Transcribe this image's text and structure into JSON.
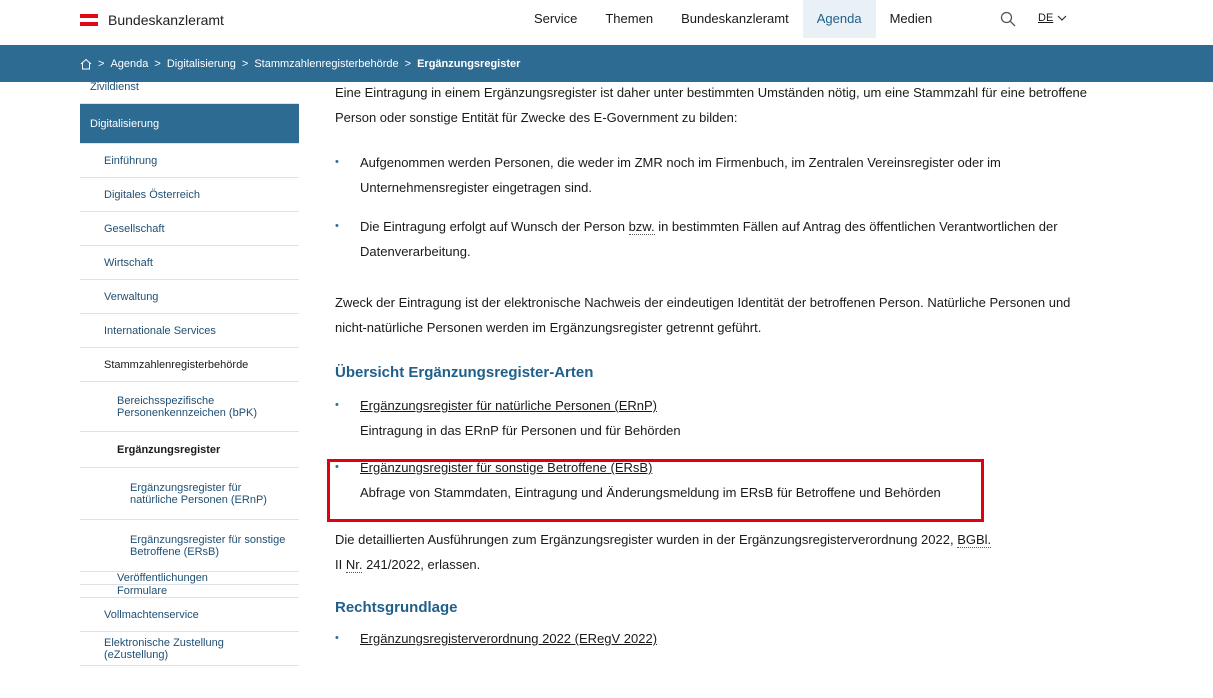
{
  "header": {
    "logo_text": "Bundeskanzleramt",
    "nav": [
      {
        "label": "Service",
        "active": false
      },
      {
        "label": "Themen",
        "active": false
      },
      {
        "label": "Bundeskanzleramt",
        "active": false
      },
      {
        "label": "Agenda",
        "active": true
      },
      {
        "label": "Medien",
        "active": false
      }
    ],
    "lang": "DE",
    "accent": "#2d6b93",
    "flag_red": "#e30613"
  },
  "breadcrumb": {
    "items": [
      "Agenda",
      "Digitalisierung",
      "Stammzahlenregisterbehörde"
    ],
    "current": "Ergänzungsregister"
  },
  "sidebar": {
    "top_partial": "Zivildienst",
    "items": [
      {
        "label": "Digitalisierung"
      },
      {
        "label": "Einführung"
      },
      {
        "label": "Digitales Österreich"
      },
      {
        "label": "Gesellschaft"
      },
      {
        "label": "Wirtschaft"
      },
      {
        "label": "Verwaltung"
      },
      {
        "label": "Internationale Services"
      },
      {
        "label": "Stammzahlenregisterbehörde"
      },
      {
        "label": "Bereichsspezifische Personenkennzeichen (bPK)"
      },
      {
        "label": "Ergänzungsregister"
      },
      {
        "label": "Ergänzungsregister für natürliche Personen (ERnP)"
      },
      {
        "label": "Ergänzungsregister für sonstige Betroffene (ERsB)"
      },
      {
        "label": "Veröffentlichungen"
      },
      {
        "label": "Formulare"
      },
      {
        "label": "Vollmachtenservice"
      },
      {
        "label": "Elektronische Zustellung (eZustellung)"
      }
    ]
  },
  "content": {
    "intro": "Eine Eintragung in einem Ergänzungsregister ist daher unter bestimmten Umständen nötig, um eine Stammzahl für eine betroffene Person oder sonstige Entität für Zwecke des E-Government zu bilden:",
    "bullet1": "Aufgenommen werden Personen, die weder im ZMR noch im Firmenbuch, im Zentralen Vereinsregister oder im Unternehmensregister eingetragen sind.",
    "bullet2_a": "Die Eintragung erfolgt auf Wunsch der Person ",
    "bullet2_abbr": "bzw.",
    "bullet2_b": " in bestimmten Fällen auf Antrag des öffentlichen Verantwortlichen der Datenverarbeitung.",
    "purpose": "Zweck der Eintragung ist der elektronische Nachweis der eindeutigen Identität der betroffenen Person. Natürliche Personen und nicht-natürliche Personen werden im Ergänzungsregister getrennt geführt.",
    "overview_heading": "Übersicht Ergänzungsregister-Arten",
    "link1": "Ergänzungsregister für natürliche Personen (ERnP)",
    "link1_desc": "Eintragung in das ERnP für Personen und für Behörden",
    "link2": "Ergänzungsregister für sonstige Betroffene (ERsB)",
    "link2_desc": "Abfrage von Stammdaten, Eintragung und Änderungsmeldung im ERsB für Betroffene und Behörden",
    "details_a": "Die detaillierten Ausführungen zum Ergänzungsregister wurden in der Ergänzungsregisterverordnung 2022, ",
    "details_bgbl": "BGBl.",
    "details_b": "II ",
    "details_nr": "Nr.",
    "details_c": " 241/2022, erlassen.",
    "legal_heading": "Rechtsgrundlage",
    "legal_link": "Ergänzungsregisterverordnung 2022 (ERegV 2022)"
  }
}
